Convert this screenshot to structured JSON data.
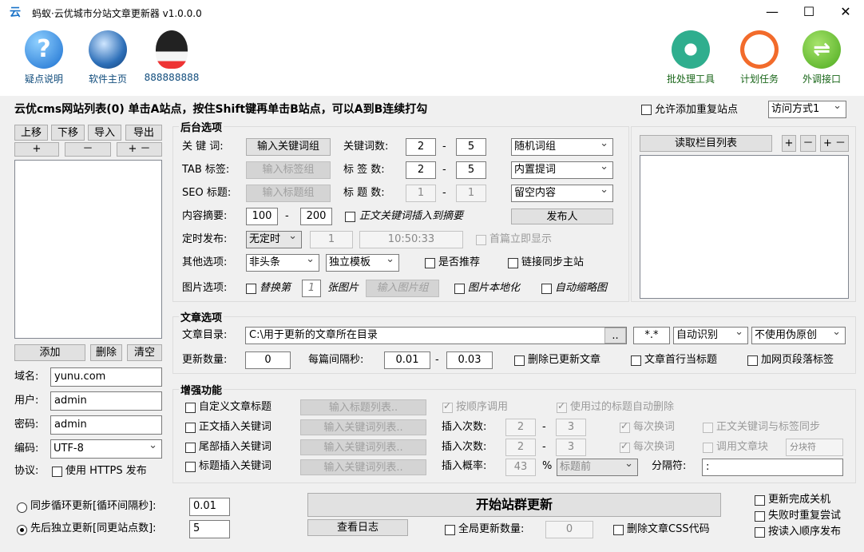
{
  "window": {
    "title": "蚂蚁·云优城市分站文章更新器 v1.0.0.0",
    "minimize": "—",
    "maximize": "☐",
    "close": "✕"
  },
  "toolbar": {
    "left": [
      {
        "label": "疑点说明",
        "icon": "help-icon"
      },
      {
        "label": "软件主页",
        "icon": "globe-icon"
      },
      {
        "label": "888888888",
        "icon": "qq-penguin-icon"
      }
    ],
    "right": [
      {
        "label": "批处理工具",
        "icon": "gear-icon"
      },
      {
        "label": "计划任务",
        "icon": "clock-icon"
      },
      {
        "label": "外调接口",
        "icon": "swap-arrows-icon"
      }
    ]
  },
  "site_list": {
    "heading": "云优cms网站列表(0)  单击A站点，按住Shift键再单击B站点，可以A到B连续打勾",
    "move_up": "上移",
    "move_down": "下移",
    "import": "导入",
    "export": "导出",
    "plus": "+",
    "minus": "－",
    "plus_minus": "+ －",
    "add": "添加",
    "delete": "删除",
    "clear": "清空",
    "domain_label": "域名:",
    "domain_value": "yunu.com",
    "user_label": "用户:",
    "user_value": "admin",
    "password_label": "密码:",
    "password_value": "admin",
    "encoding_label": "编码:",
    "encoding_value": "UTF-8",
    "protocol_label": "协议:",
    "https_label": "使用 HTTPS 发布"
  },
  "top_right": {
    "allow_duplicate": "允许添加重复站点",
    "access_mode": "访问方式1"
  },
  "backend": {
    "title": "后台选项",
    "keyword_label": "关 键 词:",
    "keyword_btn": "输入关键词组",
    "keyword_count_label": "关键词数:",
    "keyword_min": "2",
    "keyword_max": "5",
    "keyword_mode": "随机词组",
    "tab_label": "TAB 标签:",
    "tab_btn": "输入标签组",
    "tag_count_label": "标 签 数:",
    "tag_min": "2",
    "tag_max": "5",
    "tag_mode": "内置提词",
    "seo_label": "SEO 标题:",
    "seo_btn": "输入标题组",
    "title_count_label": "标 题 数:",
    "title_min": "1",
    "title_max": "1",
    "title_mode": "留空内容",
    "summary_label": "内容摘要:",
    "summary_min": "100",
    "summary_max": "200",
    "summary_insert": "正文关键词插入到摘要",
    "publisher_btn": "发布人",
    "schedule_label": "定时发布:",
    "schedule_mode": "无定时",
    "schedule_num": "1",
    "schedule_time": "10:50:33",
    "first_show": "首篇立即显示",
    "other_label": "其他选项:",
    "headline": "非头条",
    "template": "独立模板",
    "recommend": "是否推荐",
    "sync_main": "链接同步主站",
    "image_label": "图片选项:",
    "replace_pre": "替换第",
    "replace_num": "1",
    "replace_post": "张图片",
    "image_btn": "输入图片组",
    "localize": "图片本地化",
    "thumbnail": "自动缩略图",
    "dash": "-"
  },
  "column": {
    "read_btn": "读取栏目列表",
    "plus": "+",
    "minus": "－",
    "plus_minus": "+ －"
  },
  "article": {
    "title": "文章选项",
    "dir_label": "文章目录:",
    "dir_value": "C:\\用于更新的文章所在目录",
    "browse": "..",
    "ext": "*.*",
    "encoding_mode": "自动识别",
    "pseudo": "不使用伪原创",
    "count_label": "更新数量:",
    "count_value": "0",
    "interval_label": "每篇间隔秒:",
    "interval_min": "0.01",
    "interval_max": "0.03",
    "delete_updated": "删除已更新文章",
    "first_line_title": "文章首行当标题",
    "add_para_tag": "加网页段落标签",
    "dash": "-"
  },
  "enhance": {
    "title": "增强功能",
    "custom_title": "自定义文章标题",
    "title_list_btn": "输入标题列表..",
    "order_call": "按顺序调用",
    "auto_delete": "使用过的标题自动删除",
    "body_insert": "正文插入关键词",
    "kw_list_btn1": "输入关键词列表..",
    "insert_count_label1": "插入次数:",
    "ic1_min": "2",
    "ic1_max": "3",
    "each_change1": "每次换词",
    "kw_tag_sync": "正文关键词与标签同步",
    "tail_insert": "尾部插入关键词",
    "kw_list_btn2": "输入关键词列表..",
    "insert_count_label2": "插入次数:",
    "ic2_min": "2",
    "ic2_max": "3",
    "each_change2": "每次换词",
    "call_block": "调用文章块",
    "block_placeholder": "分块符",
    "title_insert": "标题插入关键词",
    "kw_list_btn3": "输入关键词列表..",
    "prob_label": "插入概率:",
    "prob_value": "43",
    "percent": "%",
    "position": "标题前",
    "separator_label": "分隔符:",
    "separator_value": ":",
    "dash": "-"
  },
  "bottom": {
    "sync_loop": "同步循环更新[循环间隔秒]:",
    "sync_value": "0.01",
    "seq_update": "先后独立更新[同更站点数]:",
    "seq_value": "5",
    "start_btn": "开始站群更新",
    "log_btn": "查看日志",
    "global_count": "全局更新数量:",
    "global_value": "0",
    "delete_css": "删除文章CSS代码",
    "shutdown": "更新完成关机",
    "retry": "失败时重复尝试",
    "order_publish": "按读入顺序发布"
  }
}
